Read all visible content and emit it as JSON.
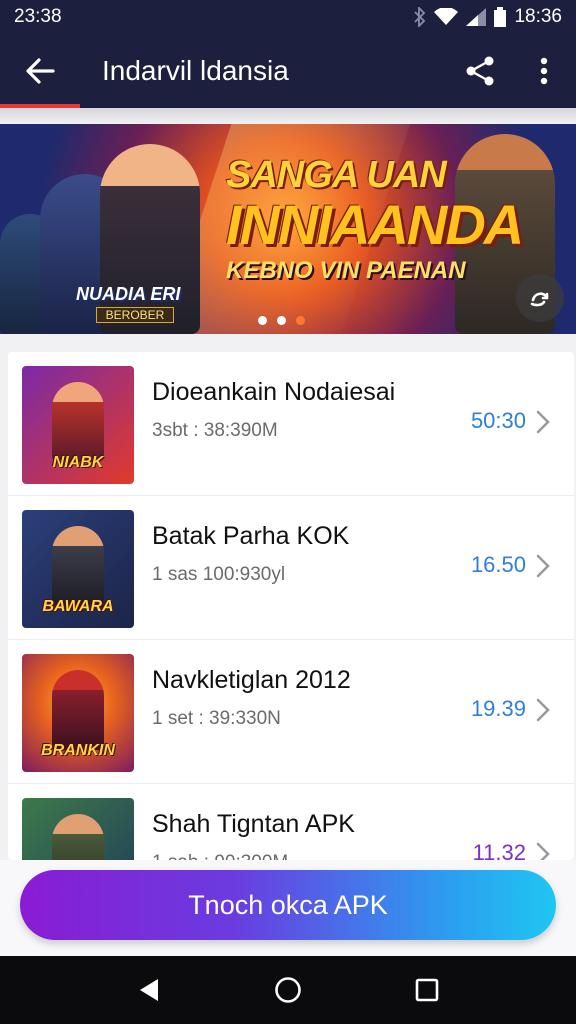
{
  "status_bar": {
    "time_left": "23:38",
    "time_right": "18:36",
    "icons": [
      "bluetooth-icon",
      "wifi-icon",
      "signal-icon",
      "battery-icon"
    ]
  },
  "app_bar": {
    "title": "Indarvil ldansia",
    "back_icon": "arrow-left-icon",
    "share_icon": "share-icon",
    "more_icon": "more-vertical-icon",
    "accent": "#e53935",
    "background": "#1c1f3d"
  },
  "banner": {
    "line1": "SANGA UAN",
    "line2": "INNIAANDA",
    "line3": "KEBNO VIN PAENAN",
    "logo_main": "NUADIA ERI",
    "logo_sub": "BEROBER",
    "slides": 3,
    "active_slide": 3,
    "action_icon": "refresh-icon"
  },
  "list": {
    "items": [
      {
        "title": "Dioeankain Nodaiesai",
        "subtitle": "3sbt : 38:390M",
        "price": "50:30",
        "thumb_label": "NIABK",
        "thumb_colors": [
          "#7a2aa8",
          "#e23a2a"
        ],
        "price_color": "#2f7fd6"
      },
      {
        "title": "Batak Parha KOK",
        "subtitle": "1 sas 100:930yl",
        "price": "16.50",
        "thumb_label": "BAWARA",
        "thumb_colors": [
          "#2b3f7a",
          "#1c2448"
        ],
        "price_color": "#2f7fd6"
      },
      {
        "title": "Navkletiglan 2012",
        "subtitle": "1 set : 39:330N",
        "price": "19.39",
        "thumb_label": "BRANKIN",
        "thumb_colors": [
          "#e8631d",
          "#7d1c5e"
        ],
        "price_color": "#2f7fd6"
      },
      {
        "title": "Shah Tigntan APK",
        "subtitle": "1 sah : 90:300M",
        "price": "11.32",
        "thumb_label": "",
        "thumb_colors": [
          "#3d7a4a",
          "#1f3b5a"
        ],
        "price_color": "#7b2fc4"
      }
    ]
  },
  "cta": {
    "label": "Tnoch okca APK",
    "gradient": [
      "#8a1bd4",
      "#1fc6f2"
    ]
  },
  "nav_bar": {
    "icons": [
      "back-triangle-icon",
      "home-circle-icon",
      "recents-square-icon"
    ]
  }
}
